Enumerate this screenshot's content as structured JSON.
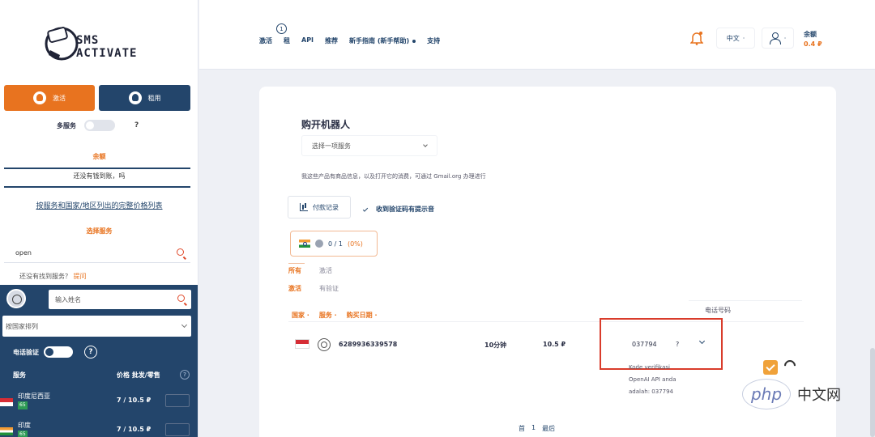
{
  "sidebar": {
    "logo_line1": "SMS",
    "logo_line2": "ACTIVATE",
    "activate_tab": "激活",
    "rent_tab": "租用",
    "multi_service_label": "多服务",
    "help_mark": "?",
    "balance_label": "余额",
    "no_balance_text": "还没有钱到账，吗",
    "price_list_link": "按服务和国家/地区列出的完整价格列表",
    "choose_service": "选择服务",
    "service_search_value": "open",
    "not_found_text": "还没有找到服务？",
    "not_found_link": "提问",
    "panel_search_placeholder": "输入姓名",
    "country_select_value": "按国家排列",
    "phone_verification_label": "电话验证",
    "table_col_service": "服务",
    "table_col_price": "价格 批发/零售",
    "rows": [
      {
        "name": "印度尼西亚",
        "badge": "65",
        "price": "7 / 10.5 ₽"
      },
      {
        "name": "印度",
        "badge": "65",
        "price": "7 / 10.5 ₽"
      }
    ]
  },
  "topbar": {
    "nav": [
      {
        "label": "激活",
        "has_dot": false
      },
      {
        "label": "租",
        "has_dot": false
      },
      {
        "label": "API",
        "has_dot": false
      },
      {
        "label": "推荐",
        "has_dot": false
      },
      {
        "label": "新手指南 (新手帮助)",
        "has_dot": true
      },
      {
        "label": "支持",
        "has_dot": false
      }
    ],
    "nav_badge": "1",
    "language": "中文",
    "balance_label": "余额",
    "balance_amount": "0.4 ₽"
  },
  "main": {
    "title": "购开机器人",
    "service_select": "选择一项服务",
    "info_text": "我这些产品有商品信息，以及打开它的消费，可通过 Gmail.org 办理进行",
    "history_button": "付款记录",
    "sms_received_label": "收到验证码有提示音",
    "country_chip_count": "0 / 1",
    "country_chip_pct": "(0%)",
    "filter_row1": [
      "所有",
      "激活"
    ],
    "filter_row2": [
      "激活",
      "有验证"
    ],
    "columns": [
      "国家",
      "服务",
      "购买日期"
    ],
    "phone_column": "电话号码",
    "order": {
      "phone": "6289936339578",
      "time": "10分钟",
      "cost": "10.5 ₽",
      "code": "037794",
      "help": "?",
      "message_lines": [
        "Kode verifikasi",
        "OpenAI API anda",
        "adalah: 037794"
      ]
    },
    "pager": [
      "首",
      "1",
      "最后"
    ]
  },
  "watermark": {
    "logo_text": "php",
    "site_text": "中文网"
  }
}
